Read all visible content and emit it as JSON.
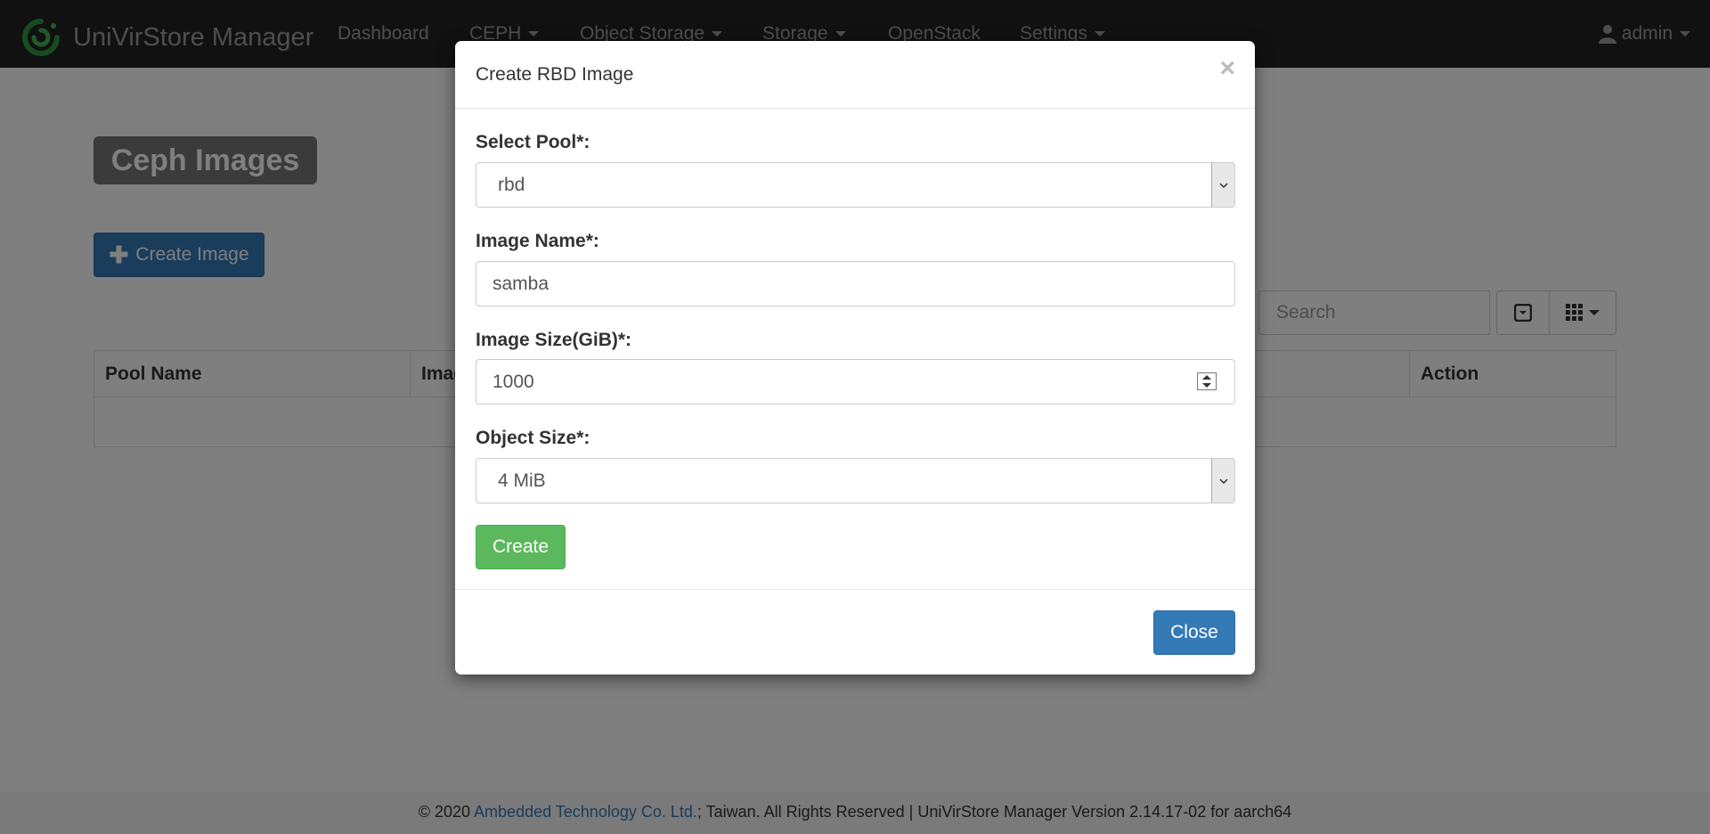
{
  "navbar": {
    "brand": "UniVirStore Manager",
    "items": [
      {
        "label": "Dashboard",
        "dropdown": false
      },
      {
        "label": "CEPH",
        "dropdown": true
      },
      {
        "label": "Object Storage",
        "dropdown": true
      },
      {
        "label": "Storage",
        "dropdown": true
      },
      {
        "label": "OpenStack",
        "dropdown": false
      },
      {
        "label": "Settings",
        "dropdown": true
      }
    ],
    "user": "admin"
  },
  "page": {
    "title": "Ceph Images",
    "create_button": "Create Image",
    "search_placeholder": "Search",
    "table_headers": [
      "Pool Name",
      "Imag",
      "Action"
    ]
  },
  "modal": {
    "title": "Create RBD Image",
    "close_x": "×",
    "pool_label": "Select Pool*:",
    "pool_value": "rbd",
    "name_label": "Image Name*:",
    "name_value": "samba",
    "size_label": "Image Size(GiB)*:",
    "size_value": "1000",
    "object_size_label": "Object Size*:",
    "object_size_value": "4 MiB",
    "create_button": "Create",
    "close_button": "Close"
  },
  "footer": {
    "prefix": "© 2020 ",
    "company": "Ambedded Technology Co. Ltd.",
    "suffix": "; Taiwan. All Rights Reserved | UniVirStore Manager Version 2.14.17-02 for aarch64"
  },
  "colors": {
    "navbar": "#222222",
    "primary": "#337ab7",
    "success": "#5cb85c",
    "brand_logo": "#2e9a3c"
  }
}
